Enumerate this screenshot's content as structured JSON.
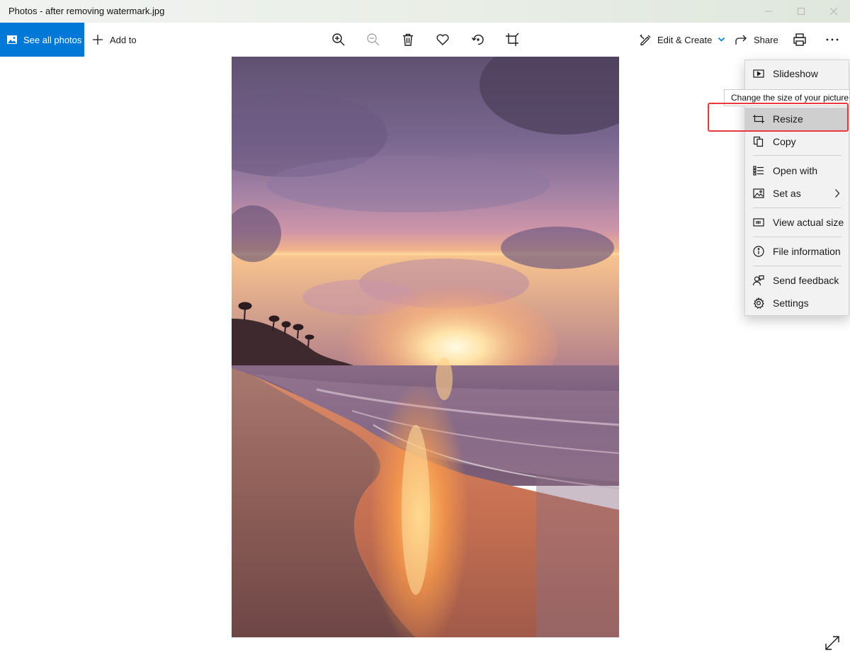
{
  "window": {
    "title": "Photos - after removing watermark.jpg"
  },
  "toolbar": {
    "see_all_label": "See all photos",
    "add_to_label": "Add to",
    "edit_create_label": "Edit & Create",
    "share_label": "Share",
    "icons": [
      "zoom-in-icon",
      "zoom-out-icon",
      "delete-icon",
      "favorite-icon",
      "rotate-icon",
      "crop-icon",
      "print-icon",
      "more-icon"
    ]
  },
  "photo": {
    "subject": "sunset beach"
  },
  "menu": {
    "items": [
      {
        "label": "Slideshow",
        "icon": "slideshow-icon"
      },
      {
        "label": "Resize",
        "icon": "resize-icon"
      },
      {
        "label": "Copy",
        "icon": "copy-icon"
      },
      {
        "label": "Open with",
        "icon": "open-with-icon"
      },
      {
        "label": "Set as",
        "icon": "set-as-icon"
      },
      {
        "label": "View actual size",
        "icon": "actual-size-icon"
      },
      {
        "label": "File information",
        "icon": "info-icon"
      },
      {
        "label": "Send feedback",
        "icon": "feedback-icon"
      },
      {
        "label": "Settings",
        "icon": "settings-icon"
      }
    ],
    "active_item": "Resize"
  },
  "tooltip": {
    "text": "Change the size of your picture"
  },
  "colors": {
    "accent": "#0078d7",
    "highlight": "#e83a3a",
    "menu_bg": "#f2f2f2"
  }
}
